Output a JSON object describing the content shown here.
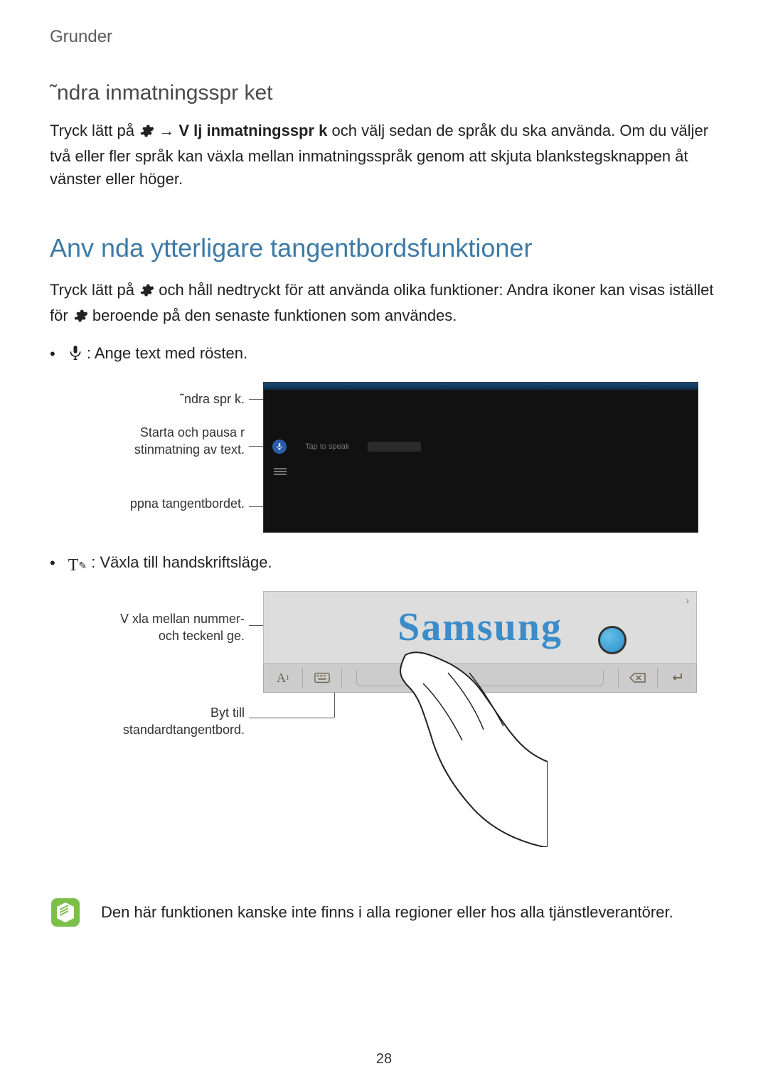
{
  "header": {
    "breadcrumb": "Grunder"
  },
  "section1": {
    "title": "˜ndra inmatningsspr ket",
    "before_icon": "Tryck lätt på ",
    "after_icon": " → ",
    "emph": "V lj inmatningsspr k",
    "rest": " och välj sedan de språk du ska använda. Om du väljer två eller fler språk kan växla mellan inmatningsspråk genom att skjuta blankstegsknappen åt vänster eller höger."
  },
  "section2": {
    "title": "Anv nda ytterligare tangentbordsfunktioner",
    "p_before": "Tryck lätt på ",
    "p_mid": " och håll nedtryckt för att använda olika funktioner: Andra ikoner kan visas istället för ",
    "p_after": " beroende på den senaste funktionen som användes."
  },
  "bullet1": {
    "text": ": Ange text med rösten."
  },
  "fig1_callouts": {
    "a": "˜ndra spr k.",
    "b": "Starta och pausa r stinmatning av text.",
    "c": "ppna tangentbordet."
  },
  "voice_panel": {
    "hint": "Tap to speak"
  },
  "bullet2": {
    "text": ": Växla till handskriftsläge."
  },
  "fig2_callouts": {
    "a": "V xla mellan nummer- och teckenl ge.",
    "b": "Byt till standardtangentbord."
  },
  "handwriting": {
    "sample": "Samsung"
  },
  "note": {
    "text": "Den här funktionen kanske inte finns i alla regioner eller hos alla tjänstleverantörer."
  },
  "page_number": "28"
}
